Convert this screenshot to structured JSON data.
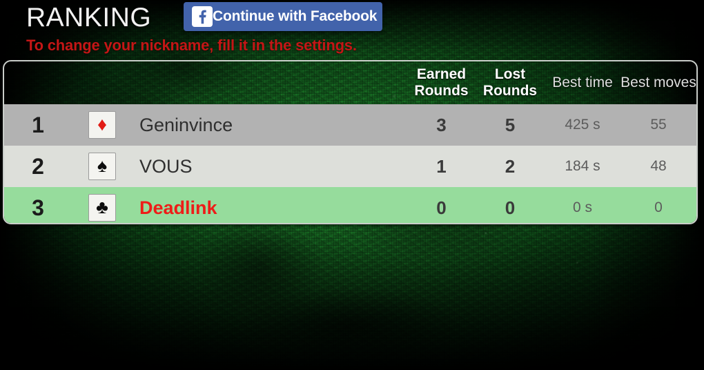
{
  "header": {
    "title": "RANKING",
    "subtitle": "To change your nickname, fill it in the settings.",
    "facebook_button": {
      "label": "Continue with Facebook",
      "icon": "facebook-f-icon",
      "bg_color": "#4263ab"
    }
  },
  "ranking_table": {
    "columns": {
      "rank": "",
      "suit": "",
      "name": "",
      "earned_rounds": "Earned Rounds",
      "lost_rounds": "Lost Rounds",
      "best_time": "Best time",
      "best_moves": "Best moves"
    },
    "rows": [
      {
        "rank": "1",
        "suit_icon": "diamond-suit-icon",
        "suit_glyph": "♦",
        "suit_color": "#e11b14",
        "name": "Geninvince",
        "earned_rounds": "3",
        "lost_rounds": "5",
        "best_time": "425 s",
        "best_moves": "55",
        "row_color": "#b2b2b2",
        "highlighted": false
      },
      {
        "rank": "2",
        "suit_icon": "spade-suit-icon",
        "suit_glyph": "♠",
        "suit_color": "#0d0d0d",
        "name": "VOUS",
        "earned_rounds": "1",
        "lost_rounds": "2",
        "best_time": "184 s",
        "best_moves": "48",
        "row_color": "#dddfda",
        "highlighted": false
      },
      {
        "rank": "3",
        "suit_icon": "club-suit-icon",
        "suit_glyph": "♣",
        "suit_color": "#0d0d0d",
        "name": "Deadlink",
        "earned_rounds": "0",
        "lost_rounds": "0",
        "best_time": "0 s",
        "best_moves": "0",
        "row_color": "#96dc9c",
        "highlighted": true
      }
    ]
  },
  "theme": {
    "background": "#0d4716",
    "title_color": "#f2f2f2",
    "subtitle_color": "#c41616",
    "highlight_name_color": "#ee1c18",
    "card_border": "#c9cdc9"
  }
}
